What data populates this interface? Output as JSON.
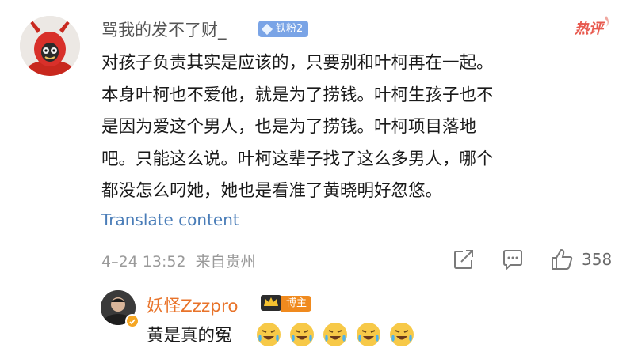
{
  "comment": {
    "username": "骂我的发不了财_",
    "fan_badge": "铁粉2",
    "hot_label": "热评",
    "lines": [
      "对孩子负责其实是应该的，只要别和叶柯再在一起。",
      "本身叶柯也不爱他，就是为了捞钱。叶柯生孩子也不",
      "是因为爱这个男人，也是为了捞钱。叶柯项目落地",
      "吧。只能这么说。叶柯这辈子找了这么多男人，哪个",
      "都没怎么叼她，她也是看准了黄晓明好忽悠。"
    ],
    "translate": "Translate content",
    "timestamp": "4–24 13:52",
    "location": "来自贵州",
    "likes": "358"
  },
  "reply": {
    "username": "妖怪Zzzpro",
    "badge": "博主",
    "text": "黄是真的冤",
    "emoji_count": 5
  },
  "colors": {
    "link": "#4a7db8",
    "reply_name": "#e8732a",
    "hot": "#e85a4f",
    "fan_badge": "#7aa4e6",
    "blogger_badge": "#f08a1e"
  }
}
